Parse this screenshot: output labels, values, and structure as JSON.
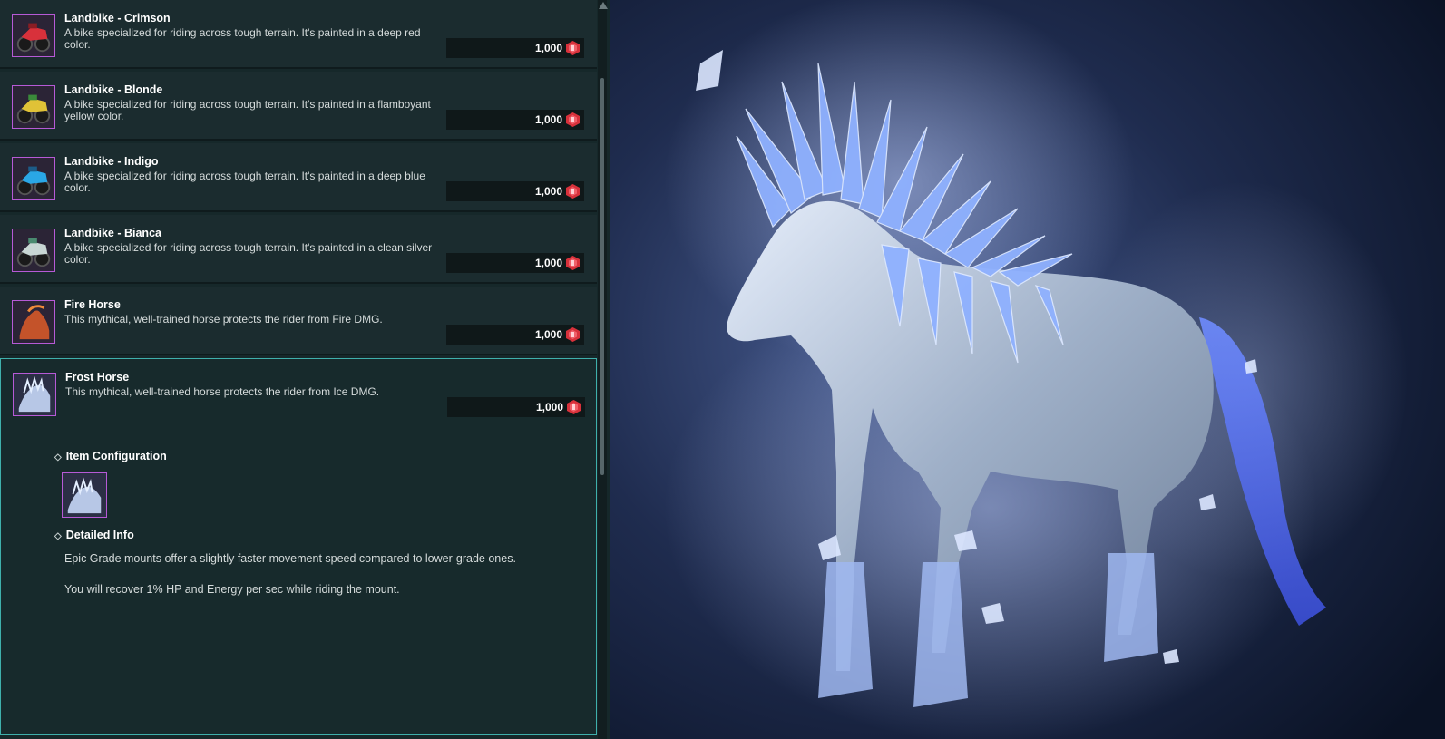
{
  "currency": {
    "icon": "red-gem-icon",
    "color": "#d8313b"
  },
  "items": [
    {
      "title": "Landbike - Crimson",
      "description": "A bike specialized for riding across tough terrain. It's painted in a deep red color.",
      "price": "1,000",
      "icon": "crimson-landbike-icon",
      "color": "#d8313b"
    },
    {
      "title": "Landbike - Blonde",
      "description": "A bike specialized for riding across tough terrain. It's painted in a flamboyant yellow color.",
      "price": "1,000",
      "icon": "blonde-landbike-icon",
      "color": "#e0c237"
    },
    {
      "title": "Landbike - Indigo",
      "description": "A bike specialized for riding across tough terrain. It's painted in a deep blue color.",
      "price": "1,000",
      "icon": "indigo-landbike-icon",
      "color": "#2aa7e6"
    },
    {
      "title": "Landbike - Bianca",
      "description": "A bike specialized for riding across tough terrain. It's painted in a clean silver color.",
      "price": "1,000",
      "icon": "bianca-landbike-icon",
      "color": "#c8d6d4"
    },
    {
      "title": "Fire Horse",
      "description": "This mythical, well-trained horse protects the rider from Fire DMG.",
      "price": "1,000",
      "icon": "fire-horse-icon",
      "color": "#c4532a"
    },
    {
      "title": "Frost Horse",
      "description": "This mythical, well-trained horse protects the rider from Ice DMG.",
      "price": "1,000",
      "icon": "frost-horse-icon",
      "color": "#a9c2ee"
    }
  ],
  "selected": {
    "config_header": "Item Configuration",
    "config_icon": "frost-horse-icon",
    "info_header": "Detailed Info",
    "info_lines": [
      "Epic Grade mounts offer a slightly faster movement speed compared to lower-grade ones.",
      "You will recover 1% HP and Energy per sec while riding the mount."
    ]
  },
  "colors": {
    "selection_border": "#3fb0ac",
    "thumb_border": "#b65ad6"
  }
}
